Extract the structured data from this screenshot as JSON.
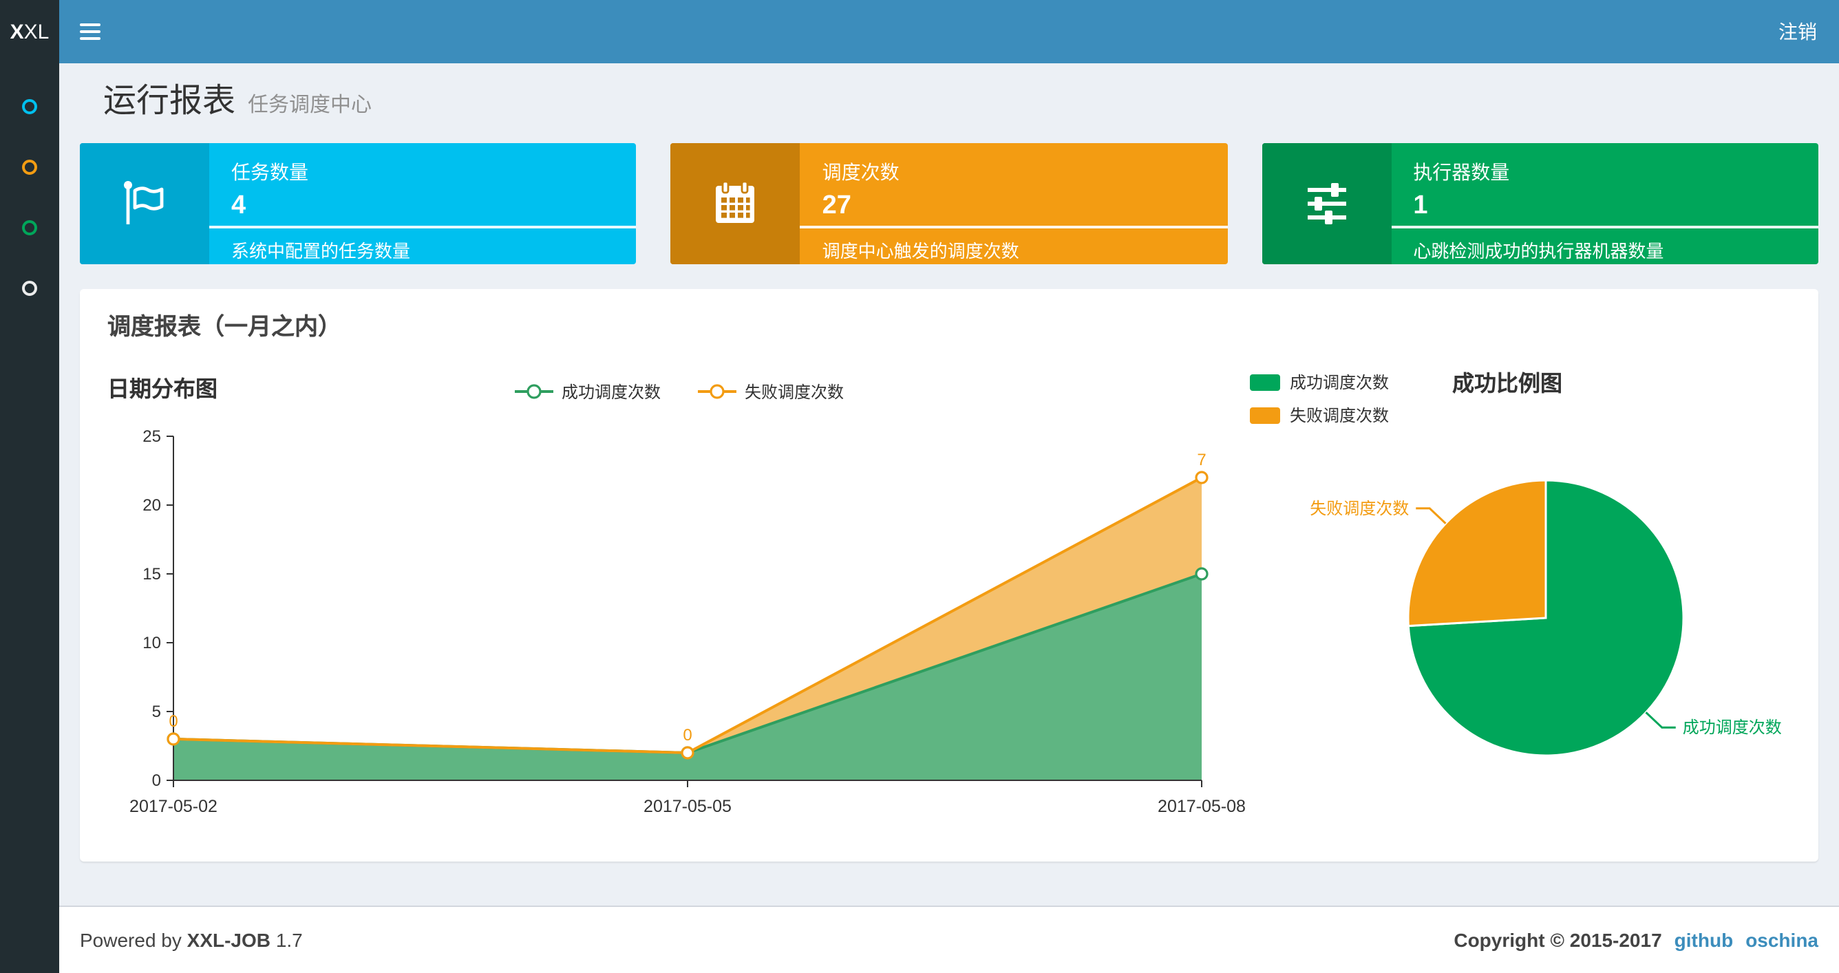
{
  "navbar": {
    "logo_bold": "X",
    "logo_rest": "XL",
    "logout_label": "注销"
  },
  "sidebar": {
    "items": [
      {
        "icon": "circle-outline-icon",
        "color": "#00c0ef"
      },
      {
        "icon": "circle-outline-icon",
        "color": "#f39c12"
      },
      {
        "icon": "circle-outline-icon",
        "color": "#00a65a"
      },
      {
        "icon": "circle-outline-icon",
        "color": "#ececec"
      }
    ]
  },
  "header": {
    "title": "运行报表",
    "subtitle": "任务调度中心"
  },
  "stat_boxes": [
    {
      "title": "任务数量",
      "value": "4",
      "desc": "系统中配置的任务数量",
      "color": "#00c0ef",
      "icon_bg": "#00a7d0",
      "icon": "flag-icon"
    },
    {
      "title": "调度次数",
      "value": "27",
      "desc": "调度中心触发的调度次数",
      "color": "#f39c12",
      "icon_bg": "#c87f0a",
      "icon": "calendar-icon"
    },
    {
      "title": "执行器数量",
      "value": "1",
      "desc": "心跳检测成功的执行器机器数量",
      "color": "#00a65a",
      "icon_bg": "#008d4c",
      "icon": "sliders-icon"
    }
  ],
  "panel": {
    "title": "调度报表（一月之内）"
  },
  "chart_data": [
    {
      "type": "area",
      "title": "日期分布图",
      "x": [
        "2017-05-02",
        "2017-05-05",
        "2017-05-08"
      ],
      "series": [
        {
          "name": "成功调度次数",
          "values": [
            3,
            2,
            15
          ],
          "color": "#2f9e5f",
          "fill": "#5fb582"
        },
        {
          "name": "失败调度次数",
          "values": [
            0,
            0,
            7
          ],
          "color": "#f39c12",
          "fill": "#f5c06c",
          "labels": [
            "0",
            "0",
            "7"
          ]
        }
      ],
      "stacked": true,
      "ylim": [
        0,
        25
      ],
      "yticks": [
        0,
        5,
        10,
        15,
        20,
        25
      ],
      "grid": false,
      "legend_position": "top-center"
    },
    {
      "type": "pie",
      "title": "成功比例图",
      "slices": [
        {
          "name": "成功调度次数",
          "value": 20,
          "color": "#00a65a"
        },
        {
          "name": "失败调度次数",
          "value": 7,
          "color": "#f39c12"
        }
      ],
      "legend_position": "top-left"
    }
  ],
  "footer": {
    "powered_prefix": "Powered by",
    "app_name": "XXL-JOB",
    "version": "1.7",
    "copyright": "Copyright © 2015-2017",
    "links": [
      "github",
      "oschina"
    ]
  }
}
